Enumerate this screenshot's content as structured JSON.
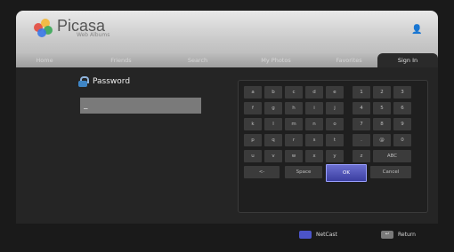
{
  "app": {
    "name": "Picasa",
    "subtitle": "Web Albums"
  },
  "nav": {
    "tabs": [
      {
        "label": "Home"
      },
      {
        "label": "Friends"
      },
      {
        "label": "Search"
      },
      {
        "label": "My Photos"
      },
      {
        "label": "Favorites"
      },
      {
        "label": "Sign In"
      }
    ]
  },
  "password": {
    "label": "Password",
    "value": "_"
  },
  "keyboard": {
    "rows": [
      [
        "a",
        "b",
        "c",
        "d",
        "e",
        "1",
        "2",
        "3"
      ],
      [
        "f",
        "g",
        "h",
        "i",
        "j",
        "4",
        "5",
        "6"
      ],
      [
        "k",
        "l",
        "m",
        "n",
        "o",
        "7",
        "8",
        "9"
      ],
      [
        "p",
        "q",
        "r",
        "s",
        "t",
        ".",
        "@",
        "0"
      ],
      [
        "u",
        "v",
        "w",
        "x",
        "y",
        "z",
        "ABC"
      ]
    ],
    "bottom": [
      "<-",
      "Space",
      "OK",
      "Cancel"
    ]
  },
  "footer": {
    "netcast_label": "NetCast",
    "netcast_key": "",
    "return_label": "Return",
    "return_key": "↩"
  },
  "colors": {
    "selected_key": "#4f55c8",
    "netcast_key_color": "#4b54c9"
  }
}
